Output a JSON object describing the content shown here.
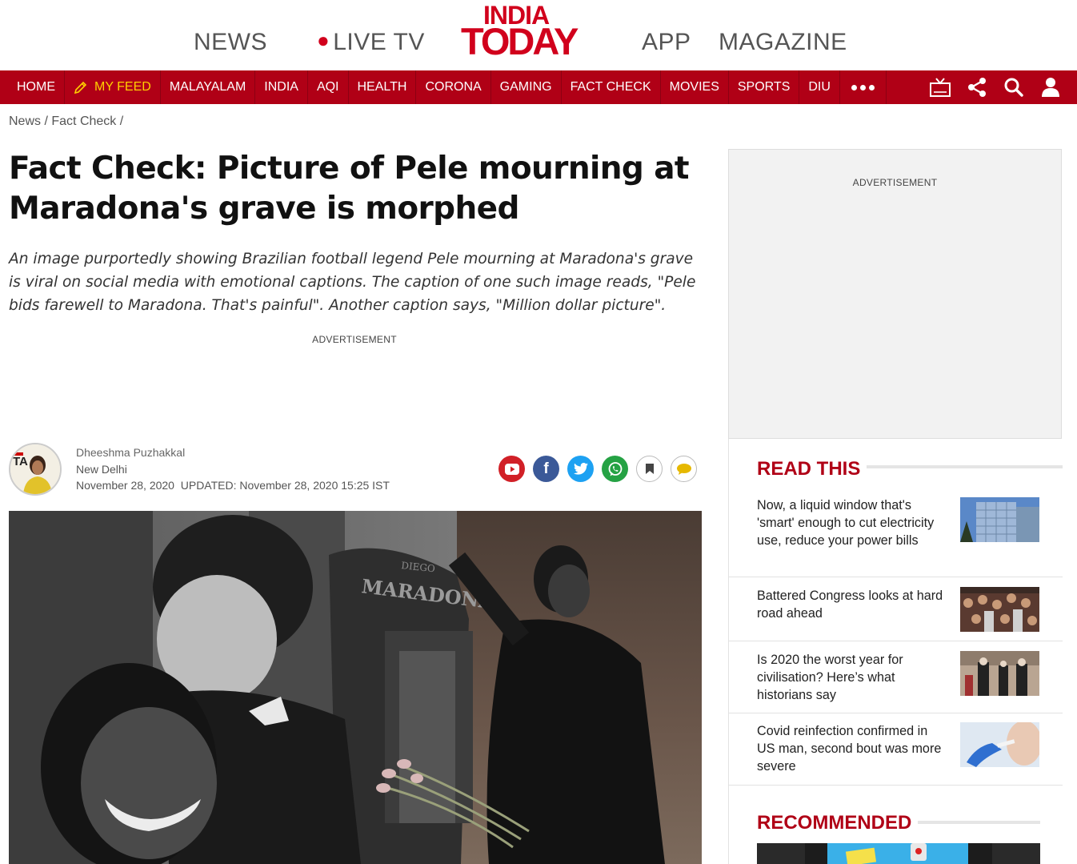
{
  "header": {
    "nav_top": [
      "NEWS",
      "LIVE TV",
      "APP",
      "MAGAZINE"
    ],
    "logo_line1": "INDIA",
    "logo_line2": "TODAY"
  },
  "nav": {
    "items": [
      "HOME",
      "MY FEED",
      "MALAYALAM",
      "INDIA",
      "AQI",
      "HEALTH",
      "CORONA",
      "GAMING",
      "FACT CHECK",
      "MOVIES",
      "SPORTS",
      "DIU"
    ],
    "right_icons": [
      "tv-icon",
      "share-icon",
      "search-icon",
      "user-icon"
    ]
  },
  "breadcrumb": {
    "items": [
      "News",
      "Fact Check"
    ],
    "separator": "/"
  },
  "article": {
    "headline": "Fact Check: Picture of Pele mourning at Maradona's grave is morphed",
    "summary": "An image purportedly showing Brazilian football legend Pele mourning at Maradona's grave is viral on social media with emotional captions. The caption of one such image reads, \"Pele bids farewell to Maradona. That's painful\". Another caption says, \"Million dollar picture\".",
    "ad_label": "ADVERTISEMENT",
    "author": "Dheeshma Puzhakkal",
    "location": "New Delhi",
    "date": "November 28, 2020",
    "updated": "UPDATED: November 28, 2020 15:25 IST",
    "share_icons": [
      "youtube-icon",
      "facebook-icon",
      "twitter-icon",
      "whatsapp-icon",
      "bookmark-icon",
      "comment-icon"
    ],
    "image_text": "MARADONA",
    "image_text_small": "DIEGO"
  },
  "sidebar": {
    "ad_label": "ADVERTISEMENT",
    "read_this_title": "READ THIS",
    "stories": [
      {
        "title": "Now, a liquid window that's 'smart' enough to cut electricity use, reduce your power bills"
      },
      {
        "title": "Battered Congress looks at hard road ahead"
      },
      {
        "title": "Is 2020 the worst year for civilisation? Here’s what historians say"
      },
      {
        "title": "Covid reinfection confirmed in US man, second bout was more severe"
      }
    ],
    "recommended_title": "RECOMMENDED"
  },
  "colors": {
    "brand_red": "#b00016",
    "logo_red": "#d1001c",
    "feed_yellow": "#ffd000"
  }
}
